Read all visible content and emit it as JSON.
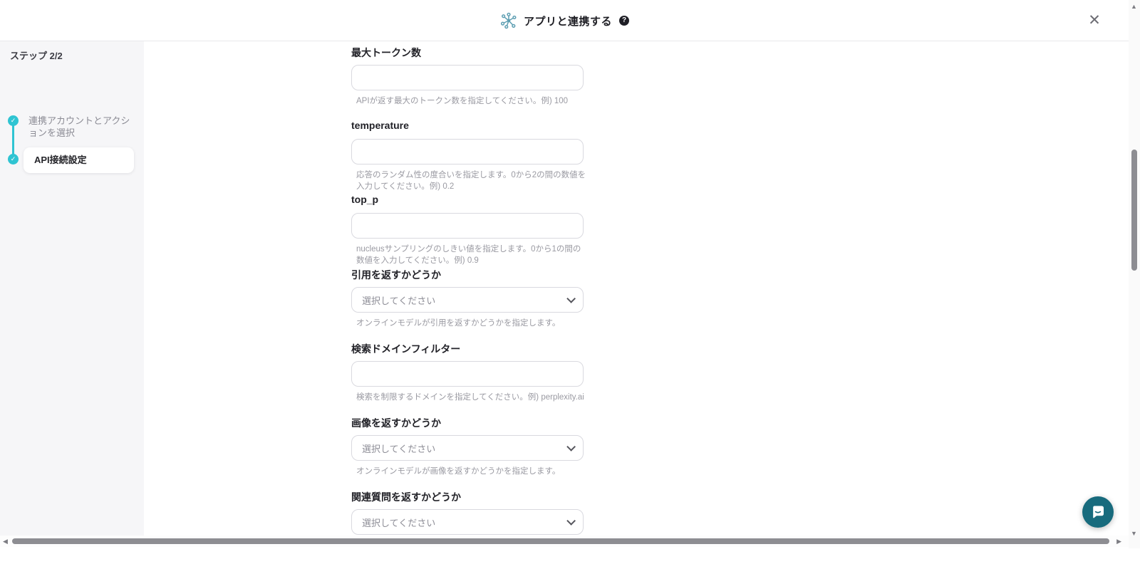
{
  "header": {
    "title": "アプリと連携する",
    "help_badge": "?",
    "close_glyph": "✕",
    "app_icon_name": "integration-network-icon"
  },
  "sidebar": {
    "step_counter": "ステップ 2/2",
    "steps": [
      {
        "label": "連携アカウントとアクションを選択",
        "state": "done",
        "check_glyph": "✓"
      },
      {
        "label": "API接続設定",
        "state": "active",
        "check_glyph": "✓"
      }
    ]
  },
  "form": {
    "fields": [
      {
        "label": "最大トークン数",
        "type": "text",
        "value": "",
        "helper": "APIが返す最大のトークン数を指定してください。例) 100"
      },
      {
        "label": "temperature",
        "type": "text",
        "value": "",
        "helper": "応答のランダム性の度合いを指定します。0から2の間の数値を入力してください。例) 0.2"
      },
      {
        "label": "top_p",
        "type": "text",
        "value": "",
        "helper": "nucleusサンプリングのしきい値を指定します。0から1の間の数値を入力してください。例) 0.9"
      },
      {
        "label": "引用を返すかどうか",
        "type": "select",
        "placeholder": "選択してください",
        "helper": "オンラインモデルが引用を返すかどうかを指定します。"
      },
      {
        "label": "検索ドメインフィルター",
        "type": "text",
        "value": "",
        "helper": "検索を制限するドメインを指定してください。例) perplexity.ai"
      },
      {
        "label": "画像を返すかどうか",
        "type": "select",
        "placeholder": "選択してください",
        "helper": "オンラインモデルが画像を返すかどうかを指定します。"
      },
      {
        "label": "関連質問を返すかどうか",
        "type": "select",
        "placeholder": "選択してください",
        "helper": ""
      }
    ]
  },
  "scrollbars": {
    "up_glyph": "▲",
    "down_glyph": "▼",
    "left_glyph": "◀",
    "right_glyph": "▶"
  },
  "colors": {
    "accent_teal": "#2fc4d2",
    "chat_teal": "#186b7d",
    "icon_teal": "#5e9fb3",
    "sidebar_bg": "#f6f6f8",
    "border": "#e9e9ec",
    "input_border": "#d9d9df",
    "helper_text": "#9a9aa2",
    "scroll_thumb": "#8d8d92"
  }
}
